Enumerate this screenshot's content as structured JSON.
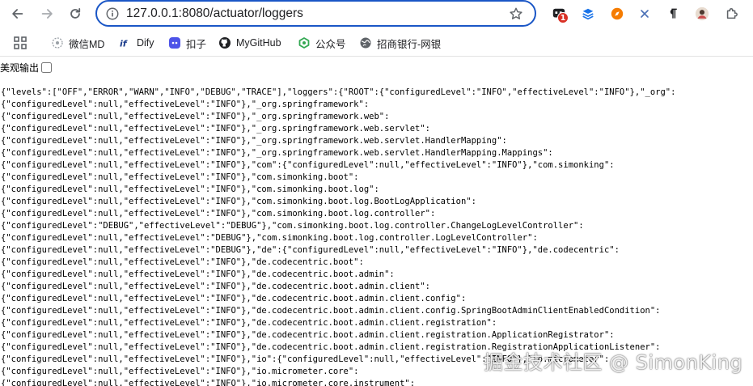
{
  "browser": {
    "url": "127.0.0.1:8080/actuator/loggers",
    "extension_badge_count": "1"
  },
  "bookmarks": [
    {
      "label": "微信MD",
      "icon": "wechat-md-icon"
    },
    {
      "label": "Dify",
      "icon": "dify-icon"
    },
    {
      "label": "扣子",
      "icon": "coze-icon"
    },
    {
      "label": "MyGitHub",
      "icon": "github-icon"
    },
    {
      "label": "公众号",
      "icon": "wechat-icon"
    },
    {
      "label": "招商银行-网银",
      "icon": "globe-icon"
    }
  ],
  "page": {
    "pretty_print_label": "美观输出",
    "pretty_print_checked": false,
    "json_lines": [
      "{\"levels\":[\"OFF\",\"ERROR\",\"WARN\",\"INFO\",\"DEBUG\",\"TRACE\"],\"loggers\":{\"ROOT\":{\"configuredLevel\":\"INFO\",\"effectiveLevel\":\"INFO\"},\"_org\":",
      "{\"configuredLevel\":null,\"effectiveLevel\":\"INFO\"},\"_org.springframework\":",
      "{\"configuredLevel\":null,\"effectiveLevel\":\"INFO\"},\"_org.springframework.web\":",
      "{\"configuredLevel\":null,\"effectiveLevel\":\"INFO\"},\"_org.springframework.web.servlet\":",
      "{\"configuredLevel\":null,\"effectiveLevel\":\"INFO\"},\"_org.springframework.web.servlet.HandlerMapping\":",
      "{\"configuredLevel\":null,\"effectiveLevel\":\"INFO\"},\"_org.springframework.web.servlet.HandlerMapping.Mappings\":",
      "{\"configuredLevel\":null,\"effectiveLevel\":\"INFO\"},\"com\":{\"configuredLevel\":null,\"effectiveLevel\":\"INFO\"},\"com.simonking\":",
      "{\"configuredLevel\":null,\"effectiveLevel\":\"INFO\"},\"com.simonking.boot\":",
      "{\"configuredLevel\":null,\"effectiveLevel\":\"INFO\"},\"com.simonking.boot.log\":",
      "{\"configuredLevel\":null,\"effectiveLevel\":\"INFO\"},\"com.simonking.boot.log.BootLogApplication\":",
      "{\"configuredLevel\":null,\"effectiveLevel\":\"INFO\"},\"com.simonking.boot.log.controller\":",
      "{\"configuredLevel\":\"DEBUG\",\"effectiveLevel\":\"DEBUG\"},\"com.simonking.boot.log.controller.ChangeLogLevelController\":",
      "{\"configuredLevel\":null,\"effectiveLevel\":\"DEBUG\"},\"com.simonking.boot.log.controller.LogLevelController\":",
      "{\"configuredLevel\":null,\"effectiveLevel\":\"DEBUG\"},\"de\":{\"configuredLevel\":null,\"effectiveLevel\":\"INFO\"},\"de.codecentric\":",
      "{\"configuredLevel\":null,\"effectiveLevel\":\"INFO\"},\"de.codecentric.boot\":",
      "{\"configuredLevel\":null,\"effectiveLevel\":\"INFO\"},\"de.codecentric.boot.admin\":",
      "{\"configuredLevel\":null,\"effectiveLevel\":\"INFO\"},\"de.codecentric.boot.admin.client\":",
      "{\"configuredLevel\":null,\"effectiveLevel\":\"INFO\"},\"de.codecentric.boot.admin.client.config\":",
      "{\"configuredLevel\":null,\"effectiveLevel\":\"INFO\"},\"de.codecentric.boot.admin.client.config.SpringBootAdminClientEnabledCondition\":",
      "{\"configuredLevel\":null,\"effectiveLevel\":\"INFO\"},\"de.codecentric.boot.admin.client.registration\":",
      "{\"configuredLevel\":null,\"effectiveLevel\":\"INFO\"},\"de.codecentric.boot.admin.client.registration.ApplicationRegistrator\":",
      "{\"configuredLevel\":null,\"effectiveLevel\":\"INFO\"},\"de.codecentric.boot.admin.client.registration.RegistrationApplicationListener\":",
      "{\"configuredLevel\":null,\"effectiveLevel\":\"INFO\"},\"io\":{\"configuredLevel\":null,\"effectiveLevel\":\"INFO\"},\"io.micrometer\":",
      "{\"configuredLevel\":null,\"effectiveLevel\":\"INFO\"},\"io.micrometer.core\":",
      "{\"configuredLevel\":null,\"effectiveLevel\":\"INFO\"},\"io.micrometer.core.instrument\":"
    ]
  },
  "watermark": "掘金技术社区 @ SimonKing",
  "colors": {
    "omnibox_border": "#1a56c6",
    "badge": "#d93025",
    "text": "#000000"
  }
}
